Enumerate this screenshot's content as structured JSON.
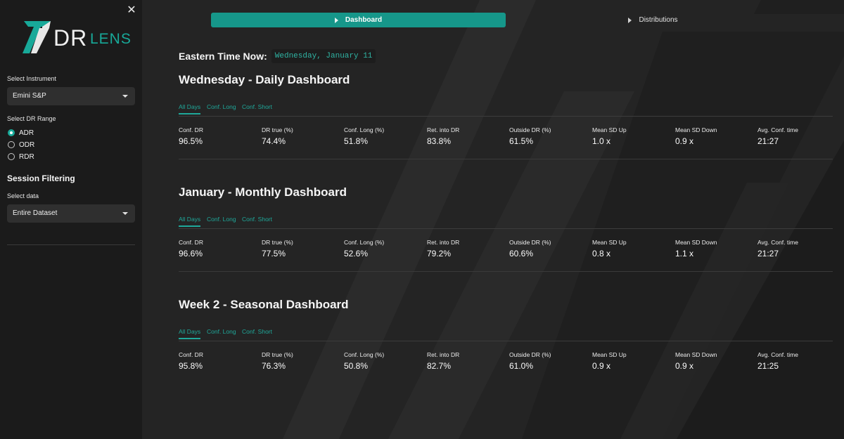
{
  "sidebar": {
    "close_icon": "close-icon",
    "logo": {
      "text_main": "DR",
      "text_sub": "LENS",
      "accent": "#18a999"
    },
    "instrument": {
      "label": "Select Instrument",
      "value": "Emini S&P"
    },
    "dr_range": {
      "label": "Select DR Range",
      "options": [
        {
          "label": "ADR",
          "selected": true
        },
        {
          "label": "ODR",
          "selected": false
        },
        {
          "label": "RDR",
          "selected": false
        }
      ]
    },
    "session_filtering": {
      "heading": "Session Filtering",
      "label": "Select data",
      "value": "Entire Dataset"
    }
  },
  "tabs": [
    {
      "label": "Dashboard",
      "active": true
    },
    {
      "label": "Distributions",
      "active": false
    }
  ],
  "clock": {
    "label": "Eastern Time Now:",
    "value": "Wednesday, January 11"
  },
  "subtab_labels": [
    "All Days",
    "Conf. Long",
    "Conf. Short"
  ],
  "metric_labels": [
    "Conf. DR",
    "DR true (%)",
    "Conf. Long (%)",
    "Ret. into DR",
    "Outside DR (%)",
    "Mean SD Up",
    "Mean SD Down",
    "Avg. Conf. time"
  ],
  "dashboards": [
    {
      "title": "Wednesday - Daily Dashboard",
      "values": [
        "96.5%",
        "74.4%",
        "51.8%",
        "83.8%",
        "61.5%",
        "1.0 x",
        "0.9 x",
        "21:27"
      ]
    },
    {
      "title": "January - Monthly Dashboard",
      "values": [
        "96.6%",
        "77.5%",
        "52.6%",
        "79.2%",
        "60.6%",
        "0.8 x",
        "1.1 x",
        "21:27"
      ]
    },
    {
      "title": "Week 2 - Seasonal Dashboard",
      "values": [
        "95.8%",
        "76.3%",
        "50.8%",
        "82.7%",
        "61.0%",
        "0.9 x",
        "0.9 x",
        "21:25"
      ]
    }
  ],
  "colors": {
    "accent": "#16978a",
    "background": "#242424",
    "sidebar": "#1b1b1b"
  }
}
